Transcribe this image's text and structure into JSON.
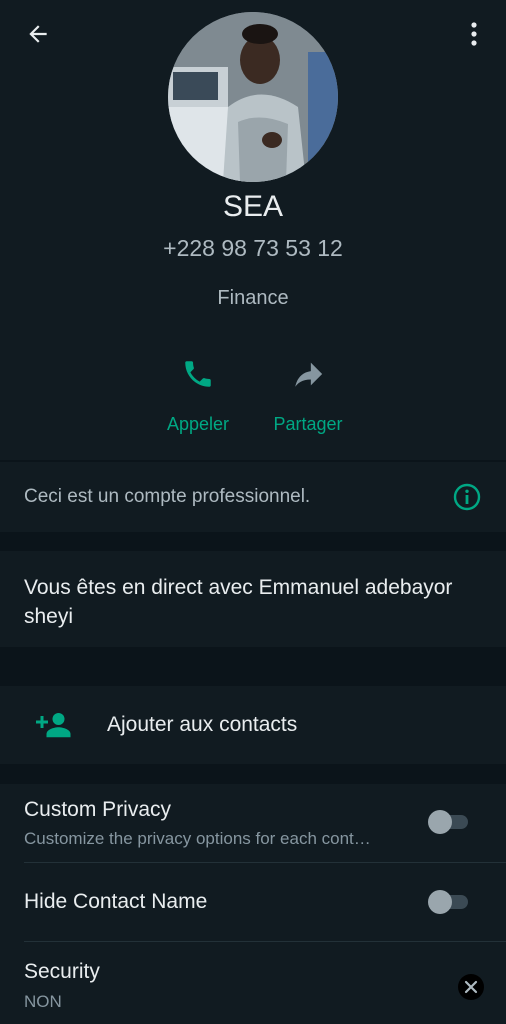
{
  "contact": {
    "name": "SEA",
    "phone": "+228 98 73 53 12",
    "category": "Finance"
  },
  "actions": {
    "call_label": "Appeler",
    "share_label": "Partager"
  },
  "business_notice": "Ceci est un compte professionnel.",
  "status_text": "Vous êtes en direct avec Emmanuel adebayor sheyi",
  "add_contact_label": "Ajouter aux contacts",
  "settings": {
    "custom_privacy": {
      "title": "Custom Privacy",
      "subtitle": "Customize the privacy options for each cont…",
      "enabled": false
    },
    "hide_contact_name": {
      "title": "Hide Contact Name",
      "enabled": false
    },
    "security": {
      "title": "Security",
      "value": "NON"
    }
  },
  "icons": {
    "back": "arrow-left-icon",
    "menu": "more-vert-icon",
    "call": "phone-icon",
    "share": "share-arrow-icon",
    "info": "info-icon",
    "add_contact": "person-add-icon",
    "close": "close-icon"
  },
  "colors": {
    "accent": "#00a884",
    "background": "#0b141a",
    "surface": "#111b21"
  }
}
